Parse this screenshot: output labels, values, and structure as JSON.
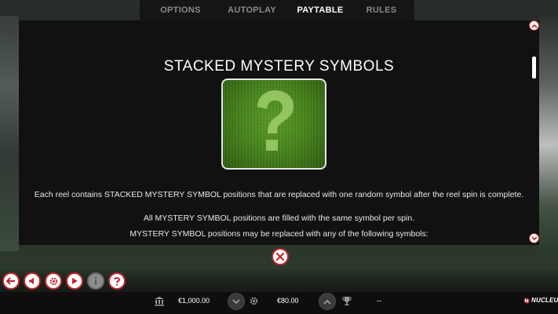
{
  "tabs": [
    {
      "label": "OPTIONS",
      "active": false
    },
    {
      "label": "AUTOPLAY",
      "active": false
    },
    {
      "label": "PAYTABLE",
      "active": true
    },
    {
      "label": "RULES",
      "active": false
    }
  ],
  "paytable": {
    "title": "STACKED MYSTERY SYMBOLS",
    "symbol_icon": "question-mark-on-grass",
    "paragraphs": [
      "Each reel contains STACKED MYSTERY SYMBOL positions that are replaced with one random symbol after the reel spin is complete.",
      "All MYSTERY SYMBOL positions are filled with the same symbol per spin.",
      "MYSTERY SYMBOL positions may be replaced with any of the following symbols:"
    ]
  },
  "controls": [
    {
      "name": "back-button",
      "icon": "back-arrow-icon",
      "enabled": true
    },
    {
      "name": "sound-button",
      "icon": "speaker-icon",
      "enabled": true
    },
    {
      "name": "settings-button",
      "icon": "gear-icon",
      "enabled": true
    },
    {
      "name": "play-button",
      "icon": "play-icon",
      "enabled": true
    },
    {
      "name": "info-button",
      "icon": "info-icon",
      "enabled": false
    },
    {
      "name": "help-button",
      "icon": "question-icon",
      "enabled": true
    }
  ],
  "status": {
    "balance": "€1,000.00",
    "bet": "€80.00",
    "win": "--",
    "brand": "NUCLEUS"
  },
  "colors": {
    "accent_red": "#c0262d",
    "panel_bg": "#111111",
    "tab_active": "#ffffff",
    "tab_inactive": "#8a8a8a"
  }
}
